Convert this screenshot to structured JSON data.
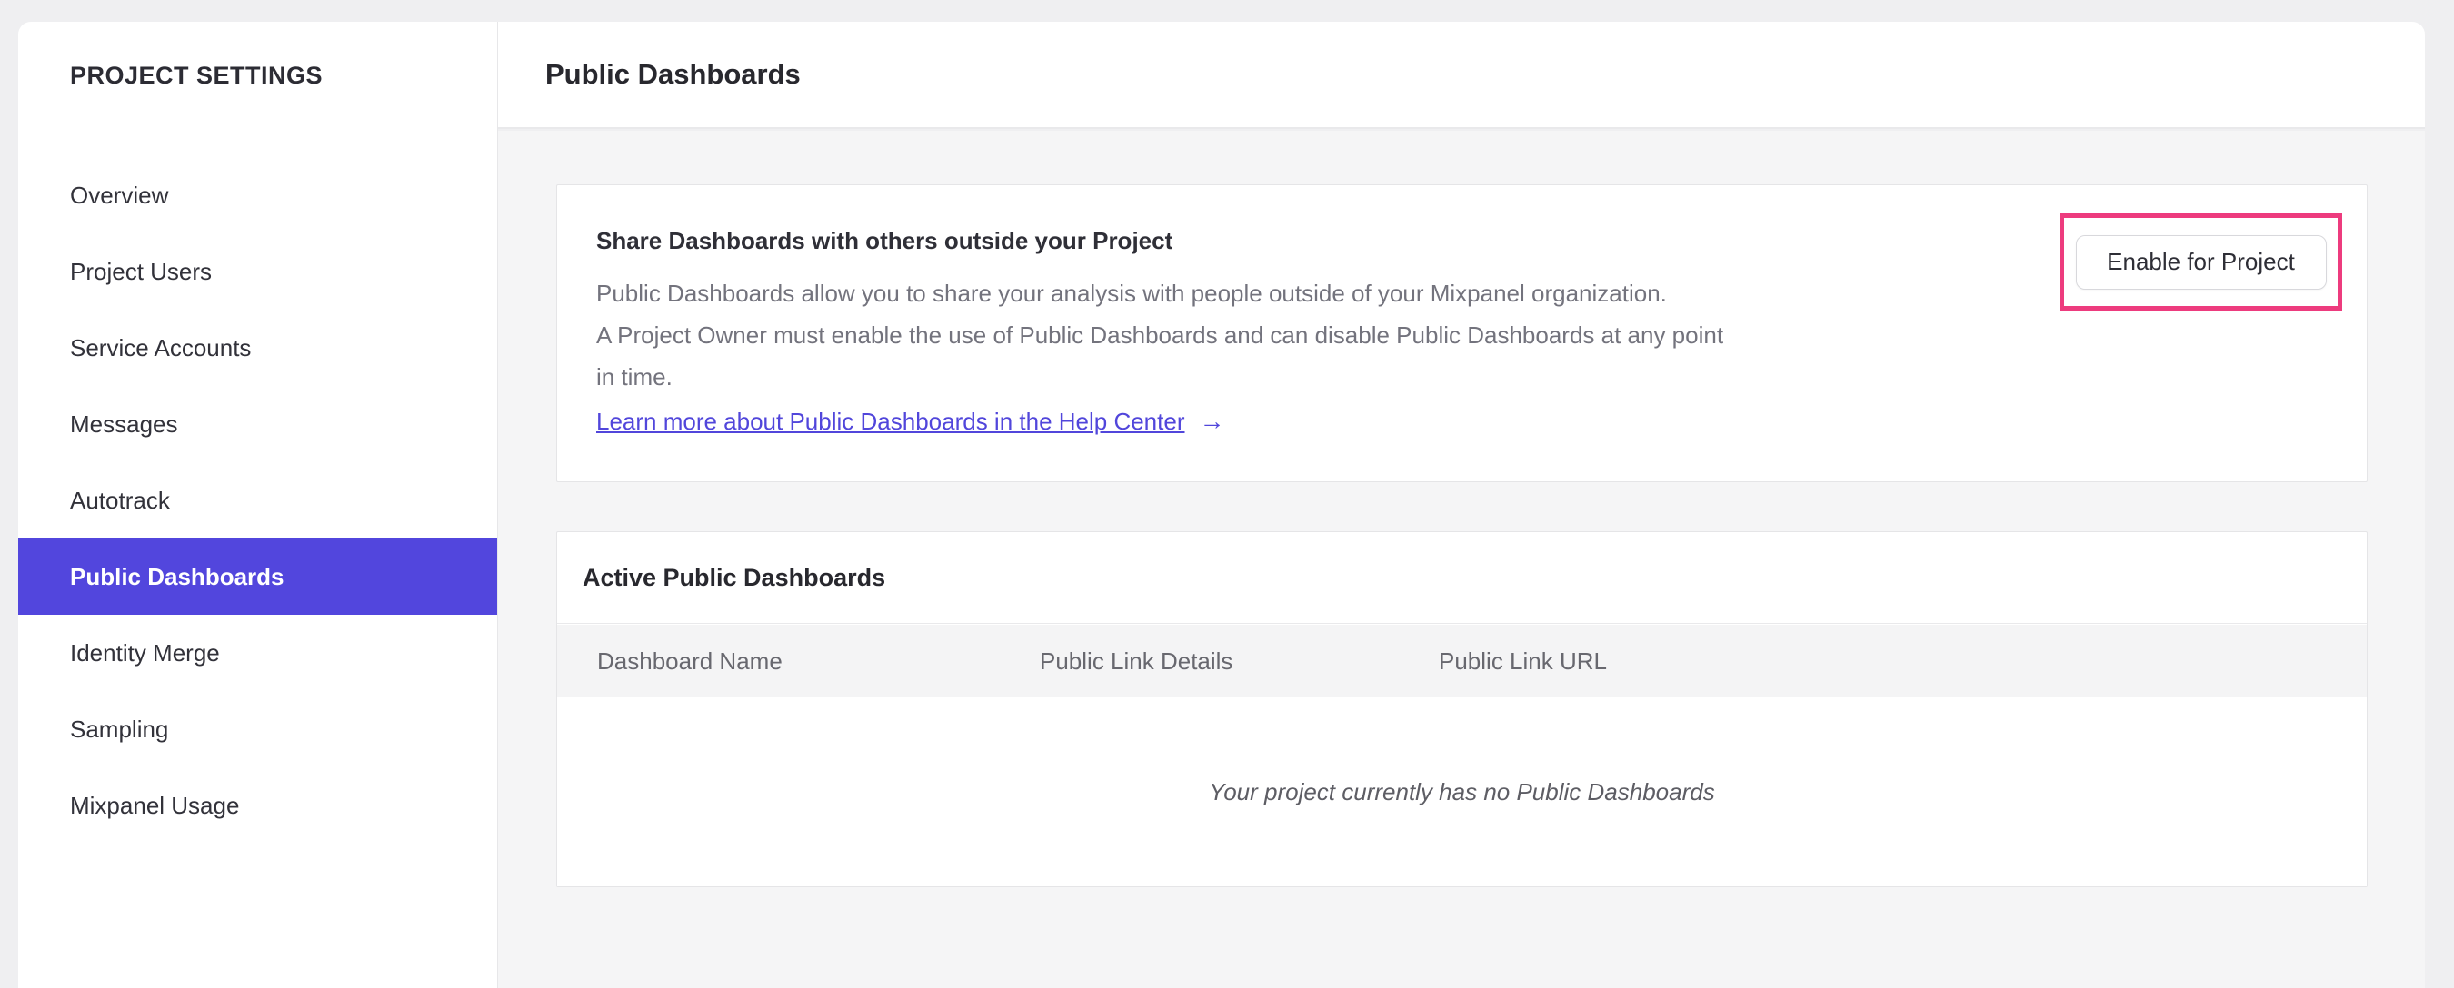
{
  "sidebar": {
    "title": "PROJECT SETTINGS",
    "items": [
      {
        "label": "Overview",
        "active": false
      },
      {
        "label": "Project Users",
        "active": false
      },
      {
        "label": "Service Accounts",
        "active": false
      },
      {
        "label": "Messages",
        "active": false
      },
      {
        "label": "Autotrack",
        "active": false
      },
      {
        "label": "Public Dashboards",
        "active": true
      },
      {
        "label": "Identity Merge",
        "active": false
      },
      {
        "label": "Sampling",
        "active": false
      },
      {
        "label": "Mixpanel Usage",
        "active": false
      }
    ]
  },
  "header": {
    "title": "Public Dashboards"
  },
  "share_card": {
    "heading": "Share Dashboards with others outside your Project",
    "description_lines": [
      "Public Dashboards allow you to share your analysis with people outside of your Mixpanel organization.",
      "A Project Owner must enable the use of Public Dashboards and can disable Public Dashboards at any point",
      "in time."
    ],
    "link_label": "Learn more about Public Dashboards in the Help Center",
    "link_arrow": "→",
    "enable_button_label": "Enable for Project"
  },
  "active_card": {
    "title": "Active Public Dashboards",
    "columns": [
      "Dashboard Name",
      "Public Link Details",
      "Public Link URL"
    ],
    "empty_message": "Your project currently has no Public Dashboards"
  },
  "colors": {
    "accent_purple": "#5246dd",
    "link_purple": "#5146db",
    "annotation_pink": "#ed3b7e",
    "content_background": "#f5f5f6",
    "page_background": "#efeff1"
  }
}
